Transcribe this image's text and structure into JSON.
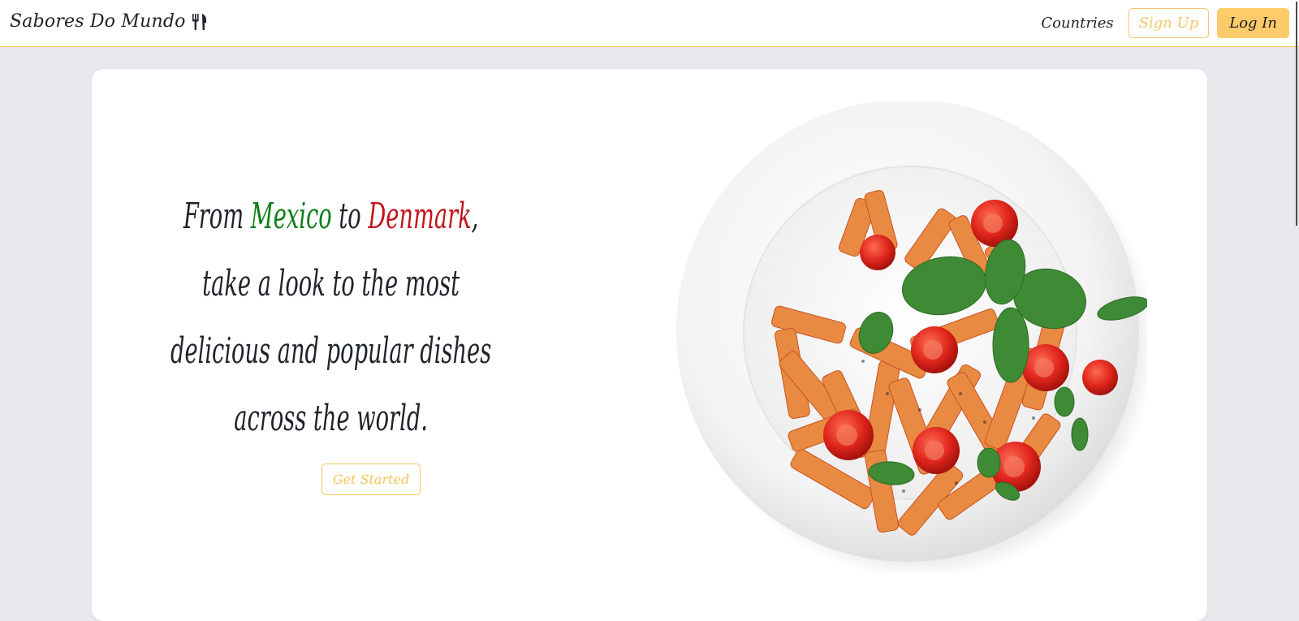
{
  "navbar": {
    "brand": "Sabores Do Mundo",
    "brand_icon": "fork-knife-icon",
    "countries_link": "Countries",
    "signup_label": "Sign Up",
    "login_label": "Log In"
  },
  "hero": {
    "line1_pre": "From ",
    "line1_mexico": "Mexico",
    "line1_mid": " to ",
    "line1_denmark": "Denmark",
    "line1_post": ",",
    "line2": "take a look to the most",
    "line3": "delicious and popular dishes",
    "line4": "across the world.",
    "cta_label": "Get Started",
    "image": "pasta-plate-image"
  },
  "colors": {
    "accent": "#fdcb6a",
    "mexico": "#0d7d16",
    "denmark": "#c3141b",
    "background": "#e7e9ec"
  }
}
